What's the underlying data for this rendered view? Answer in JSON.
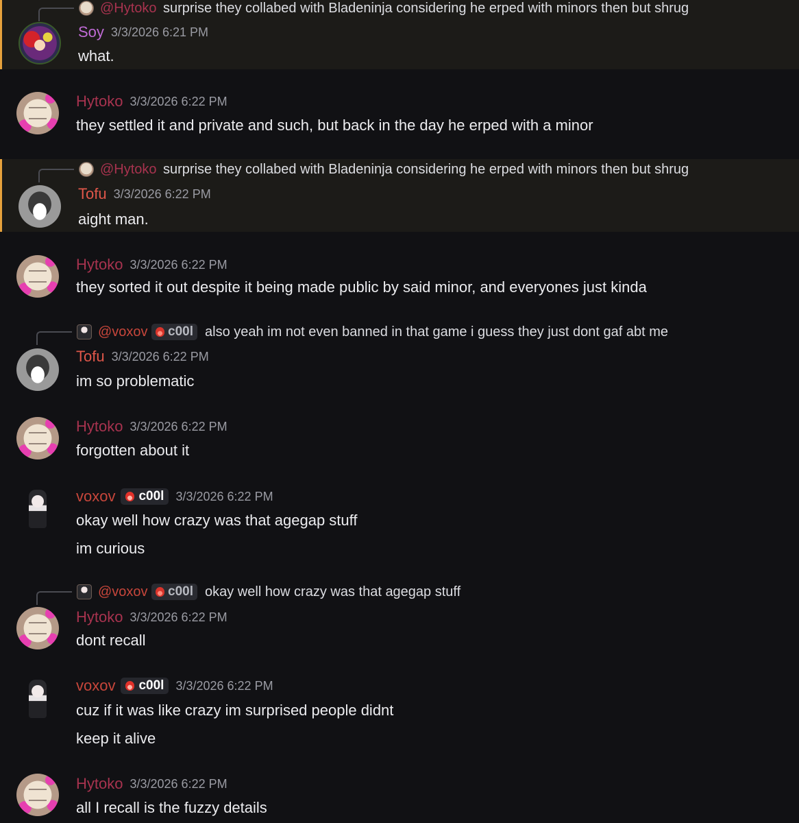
{
  "messages": [
    {
      "reply": {
        "user": "@Hytoko",
        "text": "surprise they collabed with Bladeninja considering he erped with minors then but shrug"
      },
      "user": "Soy",
      "timestamp": "3/3/2026 6:21 PM",
      "lines": [
        "what."
      ]
    },
    {
      "user": "Hytoko",
      "timestamp": "3/3/2026 6:22 PM",
      "lines": [
        "they settled it and private and such, but back in the day he erped with a minor"
      ]
    },
    {
      "reply": {
        "user": "@Hytoko",
        "text": "surprise they collabed with Bladeninja considering he erped with minors then but shrug"
      },
      "user": "Tofu",
      "timestamp": "3/3/2026 6:22 PM",
      "lines": [
        "aight man."
      ]
    },
    {
      "user": "Hytoko",
      "timestamp": "3/3/2026 6:22 PM",
      "lines": [
        "they sorted it out despite it being made public by said minor, and everyones just kinda"
      ]
    },
    {
      "reply": {
        "user": "@voxov",
        "badge": "c00l",
        "text": "also yeah im not even banned in that game i guess they just dont gaf abt me"
      },
      "user": "Tofu",
      "timestamp": "3/3/2026 6:22 PM",
      "lines": [
        "im so problematic"
      ]
    },
    {
      "user": "Hytoko",
      "timestamp": "3/3/2026 6:22 PM",
      "lines": [
        "forgotten about it"
      ]
    },
    {
      "user": "voxov",
      "badge": "c00l",
      "timestamp": "3/3/2026 6:22 PM",
      "lines": [
        "okay well how crazy was that agegap stuff",
        "im curious"
      ]
    },
    {
      "reply": {
        "user": "@voxov",
        "badge": "c00l",
        "text": "okay well how crazy was that agegap stuff"
      },
      "user": "Hytoko",
      "timestamp": "3/3/2026 6:22 PM",
      "lines": [
        "dont recall"
      ]
    },
    {
      "user": "voxov",
      "badge": "c00l",
      "timestamp": "3/3/2026 6:22 PM",
      "lines": [
        "cuz if it was like crazy im surprised people didnt",
        "keep it alive"
      ]
    },
    {
      "user": "Hytoko",
      "timestamp": "3/3/2026 6:22 PM",
      "lines": [
        "all I recall is the fuzzy details"
      ]
    }
  ],
  "colors": {
    "background": "#111114",
    "highlight": "#1c1b18",
    "highlight_bar": "#e6a23c",
    "soy": "#c06bd6",
    "hytoko": "#a8334f",
    "tofu": "#e0574a",
    "voxov": "#c7463b"
  },
  "icons": {
    "badge": "red-flame-icon"
  }
}
